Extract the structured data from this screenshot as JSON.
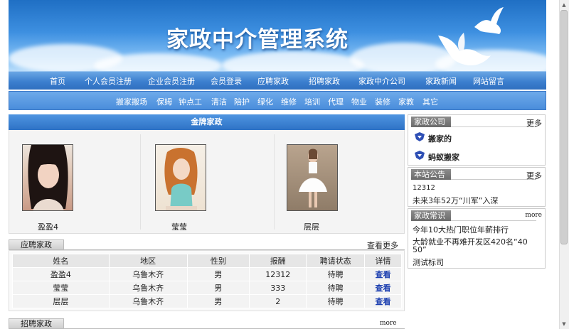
{
  "banner": {
    "title": "家政中介管理系统"
  },
  "nav_main": [
    "首页",
    "个人会员注册",
    "企业会员注册",
    "会员登录",
    "应聘家政",
    "招聘家政",
    "家政中介公司",
    "家政新闻",
    "网站留言"
  ],
  "nav_sub": [
    "搬家搬场",
    "保姆",
    "钟点工",
    "清洁",
    "陪护",
    "绿化",
    "维修",
    "培训",
    "代理",
    "物业",
    "装修",
    "家教",
    "其它"
  ],
  "gold": {
    "title": "金牌家政",
    "people": [
      {
        "name": "盈盈4"
      },
      {
        "name": "莹莹"
      },
      {
        "name": "层层"
      }
    ]
  },
  "apply": {
    "title": "应聘家政",
    "more": "查看更多",
    "columns": [
      "姓名",
      "地区",
      "性别",
      "报酬",
      "聘请状态",
      "详情"
    ],
    "rows": [
      [
        "盈盈4",
        "乌鲁木齐",
        "男",
        "12312",
        "待聘",
        "查看"
      ],
      [
        "莹莹",
        "乌鲁木齐",
        "男",
        "333",
        "待聘",
        "查看"
      ],
      [
        "层层",
        "乌鲁木齐",
        "男",
        "2",
        "待聘",
        "查看"
      ]
    ]
  },
  "recruit": {
    "title": "招聘家政",
    "more": "more"
  },
  "sidebar": {
    "companies": {
      "title": "家政公司",
      "more": "更多",
      "items": [
        "搬家的",
        "蚂蚁搬家"
      ]
    },
    "notice": {
      "title": "本站公告",
      "more": "更多",
      "items": [
        "12312",
        "未来3年52万“川军”入深"
      ]
    },
    "knowledge": {
      "title": "家政常识",
      "more": "more",
      "items": [
        "今年10大热门职位年薪排行",
        "大龄就业不再难开发区420名“40",
        "50”",
        "测试标司"
      ]
    }
  },
  "colors": {
    "accent": "#2e72c5",
    "link": "#1c3fb0"
  }
}
